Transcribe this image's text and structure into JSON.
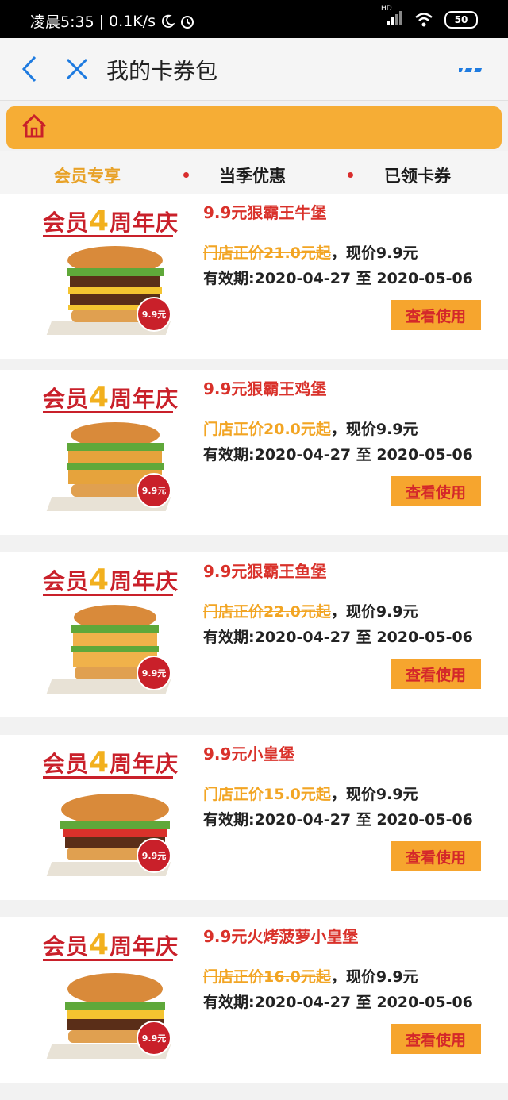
{
  "status": {
    "time": "凌晨5:35",
    "separator": "|",
    "speed": "0.1K/s",
    "battery": "50",
    "hd": "HD"
  },
  "header": {
    "title": "我的卡券包",
    "back_icon": "chevron-left-icon",
    "close_icon": "close-icon",
    "more_icon": "more-icon"
  },
  "tabs": [
    {
      "label": "会员专享",
      "active": true
    },
    {
      "label": "当季优惠",
      "active": false
    },
    {
      "label": "已领卡券",
      "active": false
    }
  ],
  "promo": {
    "logo_prefix": "会员",
    "logo_num": "4",
    "logo_suffix": "周年庆",
    "badge": "9.9元"
  },
  "coupons": [
    {
      "name": "9.9元狠霸王牛堡",
      "original": "门店正价21.0元起",
      "current": "，现价9.9元",
      "validity": "有效期:2020-04-27 至 2020-05-06",
      "button": "查看使用"
    },
    {
      "name": "9.9元狠霸王鸡堡",
      "original": "门店正价20.0元起",
      "current": "，现价9.9元",
      "validity": "有效期:2020-04-27 至 2020-05-06",
      "button": "查看使用"
    },
    {
      "name": "9.9元狠霸王鱼堡",
      "original": "门店正价22.0元起",
      "current": "，现价9.9元",
      "validity": "有效期:2020-04-27 至 2020-05-06",
      "button": "查看使用"
    },
    {
      "name": "9.9元小皇堡",
      "original": "门店正价15.0元起",
      "current": "，现价9.9元",
      "validity": "有效期:2020-04-27 至 2020-05-06",
      "button": "查看使用"
    },
    {
      "name": "9.9元火烤菠萝小皇堡",
      "original": "门店正价16.0元起",
      "current": "，现价9.9元",
      "validity": "有效期:2020-04-27 至 2020-05-06",
      "button": "查看使用"
    }
  ],
  "colors": {
    "accent": "#f6ad35",
    "active_tab": "#e8a228",
    "brand_red": "#c9202a",
    "icon_blue": "#1e7be0"
  }
}
